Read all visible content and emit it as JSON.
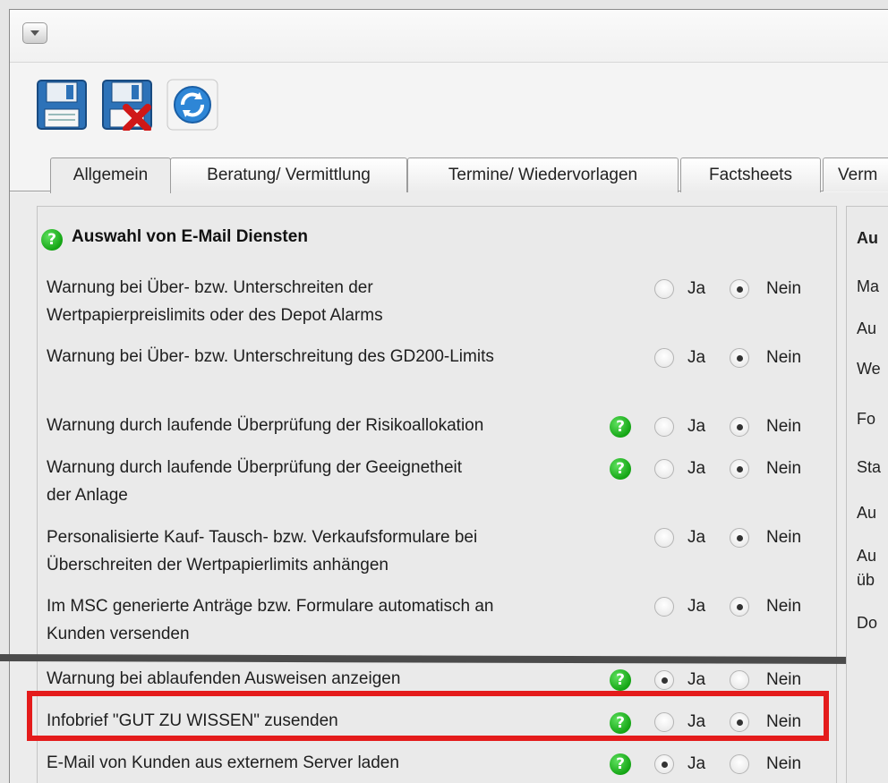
{
  "toolbar": {
    "buttons": [
      {
        "icon": "save-icon"
      },
      {
        "icon": "save-discard-icon"
      },
      {
        "icon": "refresh-icon"
      }
    ]
  },
  "tabs": [
    "Allgemein",
    "Beratung/ Vermittlung",
    "Termine/ Wiedervorlagen",
    "Factsheets",
    "Verm"
  ],
  "section": {
    "title": "Auswahl von E-Mail Diensten",
    "options": [
      "Ja",
      "Nein"
    ],
    "rows": [
      {
        "lines": [
          "Warnung bei Über- bzw. Unterschreiten der",
          "Wertpapierpreislimits oder des Depot Alarms"
        ],
        "selected": "Nein"
      },
      {
        "lines": [
          "Warnung bei Über- bzw. Unterschreitung des GD200-Limits"
        ],
        "selected": "Nein"
      },
      {
        "lines": [
          "Warnung durch laufende Überprüfung der Risikoallokation"
        ],
        "selected": "Nein"
      },
      {
        "lines": [
          "Warnung durch laufende Überprüfung der Geeignetheit",
          "der Anlage"
        ],
        "selected": "Nein"
      },
      {
        "lines": [
          "Personalisierte Kauf- Tausch- bzw. Verkaufsformulare bei",
          "Überschreiten der Wertpapierlimits anhängen"
        ],
        "selected": "Nein"
      },
      {
        "lines": [
          "Im MSC generierte Anträge bzw. Formulare automatisch an",
          "Kunden versenden"
        ],
        "selected": "Nein"
      },
      {
        "lines": [
          "Warnung bei ablaufenden Ausweisen anzeigen"
        ],
        "selected": "Ja"
      },
      {
        "lines": [
          "Infobrief \"GUT ZU WISSEN\" zusenden"
        ],
        "selected": "Nein"
      },
      {
        "lines": [
          "E-Mail von Kunden aus externem Server laden"
        ],
        "selected": "Ja"
      }
    ]
  },
  "right_panel": {
    "title": "Au",
    "items": [
      "Ma",
      "Au",
      "We",
      "Fo",
      "Sta",
      "Au",
      "Au",
      "üb",
      "Do"
    ]
  },
  "colors": {
    "highlight": "#e41b1b",
    "help": "#14a514"
  }
}
